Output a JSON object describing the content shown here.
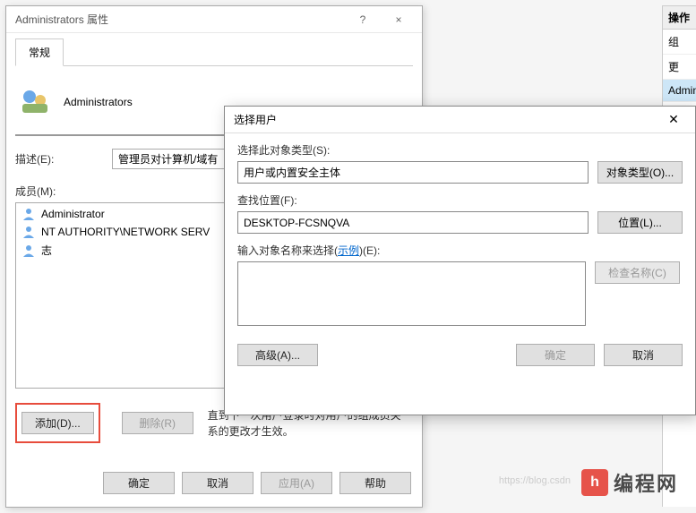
{
  "prop_dialog": {
    "title": "Administrators 属性",
    "help_btn": "?",
    "close_btn": "×",
    "tab_general": "常规",
    "group_name": "Administrators",
    "desc_label": "描述(E):",
    "desc_value": "管理员对计算机/域有",
    "members_label": "成员(M):",
    "members": [
      {
        "name": "Administrator",
        "icon": "user"
      },
      {
        "name": "NT AUTHORITY\\NETWORK SERV",
        "icon": "user"
      },
      {
        "name": "志",
        "icon": "user"
      }
    ],
    "add_btn": "添加(D)...",
    "remove_btn": "删除(R)",
    "help_text_line1": "直到下一次用户登录时对用户的组成员关",
    "help_text_line2": "系的更改才生效。",
    "ok_btn": "确定",
    "cancel_btn": "取消",
    "apply_btn": "应用(A)",
    "help_btn_bottom": "帮助"
  },
  "select_dialog": {
    "title": "选择用户",
    "close_btn": "✕",
    "obj_type_label": "选择此对象类型(S):",
    "obj_type_value": "用户或内置安全主体",
    "obj_type_btn": "对象类型(O)...",
    "location_label": "查找位置(F):",
    "location_value": "DESKTOP-FCSNQVA",
    "location_btn": "位置(L)...",
    "names_label_pre": "输入对象名称来选择(",
    "names_label_link": "示例",
    "names_label_post": ")(E):",
    "names_value": "",
    "check_btn": "检查名称(C)",
    "advanced_btn": "高级(A)...",
    "ok_btn": "确定",
    "cancel_btn": "取消"
  },
  "actions_panel": {
    "header": "操作",
    "item1": "组",
    "item2": "更",
    "item3": "Admini"
  },
  "watermark": {
    "logo": "h",
    "text": "编程网",
    "url": "https://blog.csdn"
  }
}
